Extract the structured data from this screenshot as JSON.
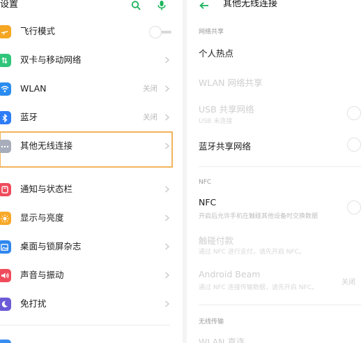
{
  "left": {
    "title": "设置",
    "icons": {
      "search": "search-icon",
      "mic": "mic-icon"
    },
    "accent": "#1bb35b",
    "rows": [
      {
        "label": "飞行模式",
        "icon": "airplane-icon",
        "color": "#f5a623",
        "toggle": "off"
      },
      {
        "label": "双卡与移动网络",
        "icon": "sim-icon",
        "color": "#2fc57a"
      },
      {
        "label": "WLAN",
        "value": "关闭",
        "icon": "wifi-icon",
        "color": "#2a8cf0"
      },
      {
        "label": "蓝牙",
        "value": "关闭",
        "icon": "bluetooth-icon",
        "color": "#2e7cf6"
      },
      {
        "label": "其他无线连接",
        "icon": "more-icon",
        "color": "#a8adbb",
        "highlighted": true
      },
      {
        "label": "通知与状态栏",
        "icon": "notification-icon",
        "color": "#ef4b5c"
      },
      {
        "label": "显示与亮度",
        "icon": "sun-icon",
        "color": "#f7a928"
      },
      {
        "label": "桌面与锁屏杂志",
        "icon": "wallpaper-icon",
        "color": "#2f86ee"
      },
      {
        "label": "声音与振动",
        "icon": "speaker-icon",
        "color": "#ef4b5c"
      },
      {
        "label": "免打扰",
        "icon": "moon-icon",
        "color": "#6b5bd6"
      }
    ],
    "highlight_color": "#f2b45b"
  },
  "right": {
    "title": "其他无线连接",
    "back_icon": "back-arrow-icon",
    "sections": {
      "hotspot": "网络共享",
      "nfc": "NFC",
      "wireless": "无线传输"
    },
    "items": {
      "hotspot": "个人热点",
      "wlan_share": "WLAN 网络共享",
      "usb_share": "USB 共享网络",
      "usb_sub": "USB 未连接",
      "bt_share": "蓝牙共享网络",
      "nfc": "NFC",
      "nfc_sub": "开启后允许手机在触碰其他设备时交换数据",
      "touch_pay": "触碰付款",
      "touch_pay_sub": "通过 NFC 进行支付，请先开启 NFC。",
      "beam": "Android Beam",
      "beam_sub": "通过 NFC 连接传输数据，请先开启 NFC。",
      "beam_value": "关闭",
      "wlan_direct": "WLAN 直连"
    }
  }
}
